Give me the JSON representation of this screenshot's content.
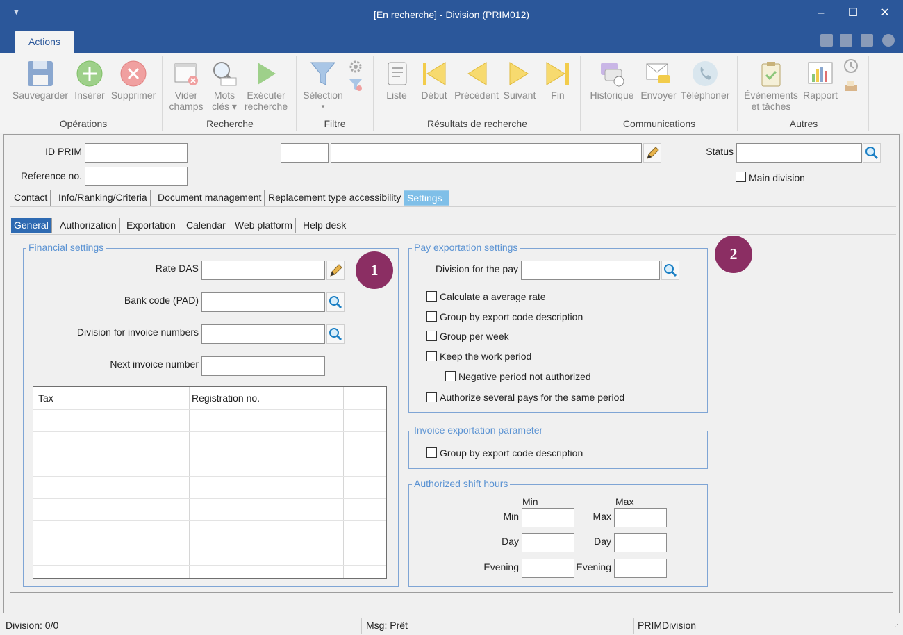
{
  "window": {
    "title": "[En recherche] - Division (PRIM012)",
    "controls": {
      "minimize": "–",
      "maximize": "☐",
      "close": "✕"
    }
  },
  "ribbon": {
    "tab": "Actions",
    "groups": {
      "operations": "Opérations",
      "recherche": "Recherche",
      "filtre": "Filtre",
      "resultats": "Résultats de recherche",
      "communications": "Communications",
      "autres": "Autres"
    },
    "buttons": {
      "sauvegarder": "Sauvegarder",
      "inserer": "Insérer",
      "supprimer": "Supprimer",
      "vider_1": "Vider",
      "vider_2": "champs",
      "mots_1": "Mots",
      "mots_2": "clés ▾",
      "executer_1": "Exécuter",
      "executer_2": "recherche",
      "selection": "Sélection",
      "selection_arrow": "▾",
      "liste": "Liste",
      "debut": "Début",
      "precedent": "Précédent",
      "suivant": "Suivant",
      "fin": "Fin",
      "historique": "Historique",
      "envoyer": "Envoyer",
      "telephoner": "Téléphoner",
      "evenements_1": "Évènements",
      "evenements_2": "et tâches",
      "rapport": "Rapport"
    }
  },
  "header": {
    "id_prim_label": "ID PRIM",
    "reference_label": "Reference no.",
    "status_label": "Status",
    "main_division_label": "Main division"
  },
  "tabs_main": [
    "Contact",
    "Info/Ranking/Criteria",
    "Document management",
    "Replacement type accessibility",
    "Settings"
  ],
  "tabs_sub": [
    "General",
    "Authorization",
    "Exportation",
    "Calendar",
    "Web platform",
    "Help desk"
  ],
  "financial": {
    "legend": "Financial settings",
    "rate_das": "Rate DAS",
    "bank_code": "Bank code (PAD)",
    "division_invoice": "Division for invoice numbers",
    "next_invoice": "Next invoice number",
    "grid_cols": [
      "Tax",
      "Registration no."
    ]
  },
  "pay": {
    "legend": "Pay exportation settings",
    "division_pay": "Division for the pay",
    "checks": [
      "Calculate a average rate",
      "Group by export code description",
      "Group per week",
      "Keep the work period",
      "Negative period not authorized",
      "Authorize several pays for the same period"
    ]
  },
  "invoice": {
    "legend": "Invoice exportation parameter",
    "check": "Group by export code description"
  },
  "shift": {
    "legend": "Authorized shift hours",
    "min_header": "Min",
    "max_header": "Max",
    "rows": [
      "Min",
      "Day",
      "Evening"
    ],
    "rows_right": [
      "Max",
      "Day",
      "Evening"
    ]
  },
  "badges": [
    "1",
    "2"
  ],
  "statusbar": {
    "division": "Division: 0/0",
    "msg": "Msg: Prêt",
    "app": "PRIMDivision"
  }
}
